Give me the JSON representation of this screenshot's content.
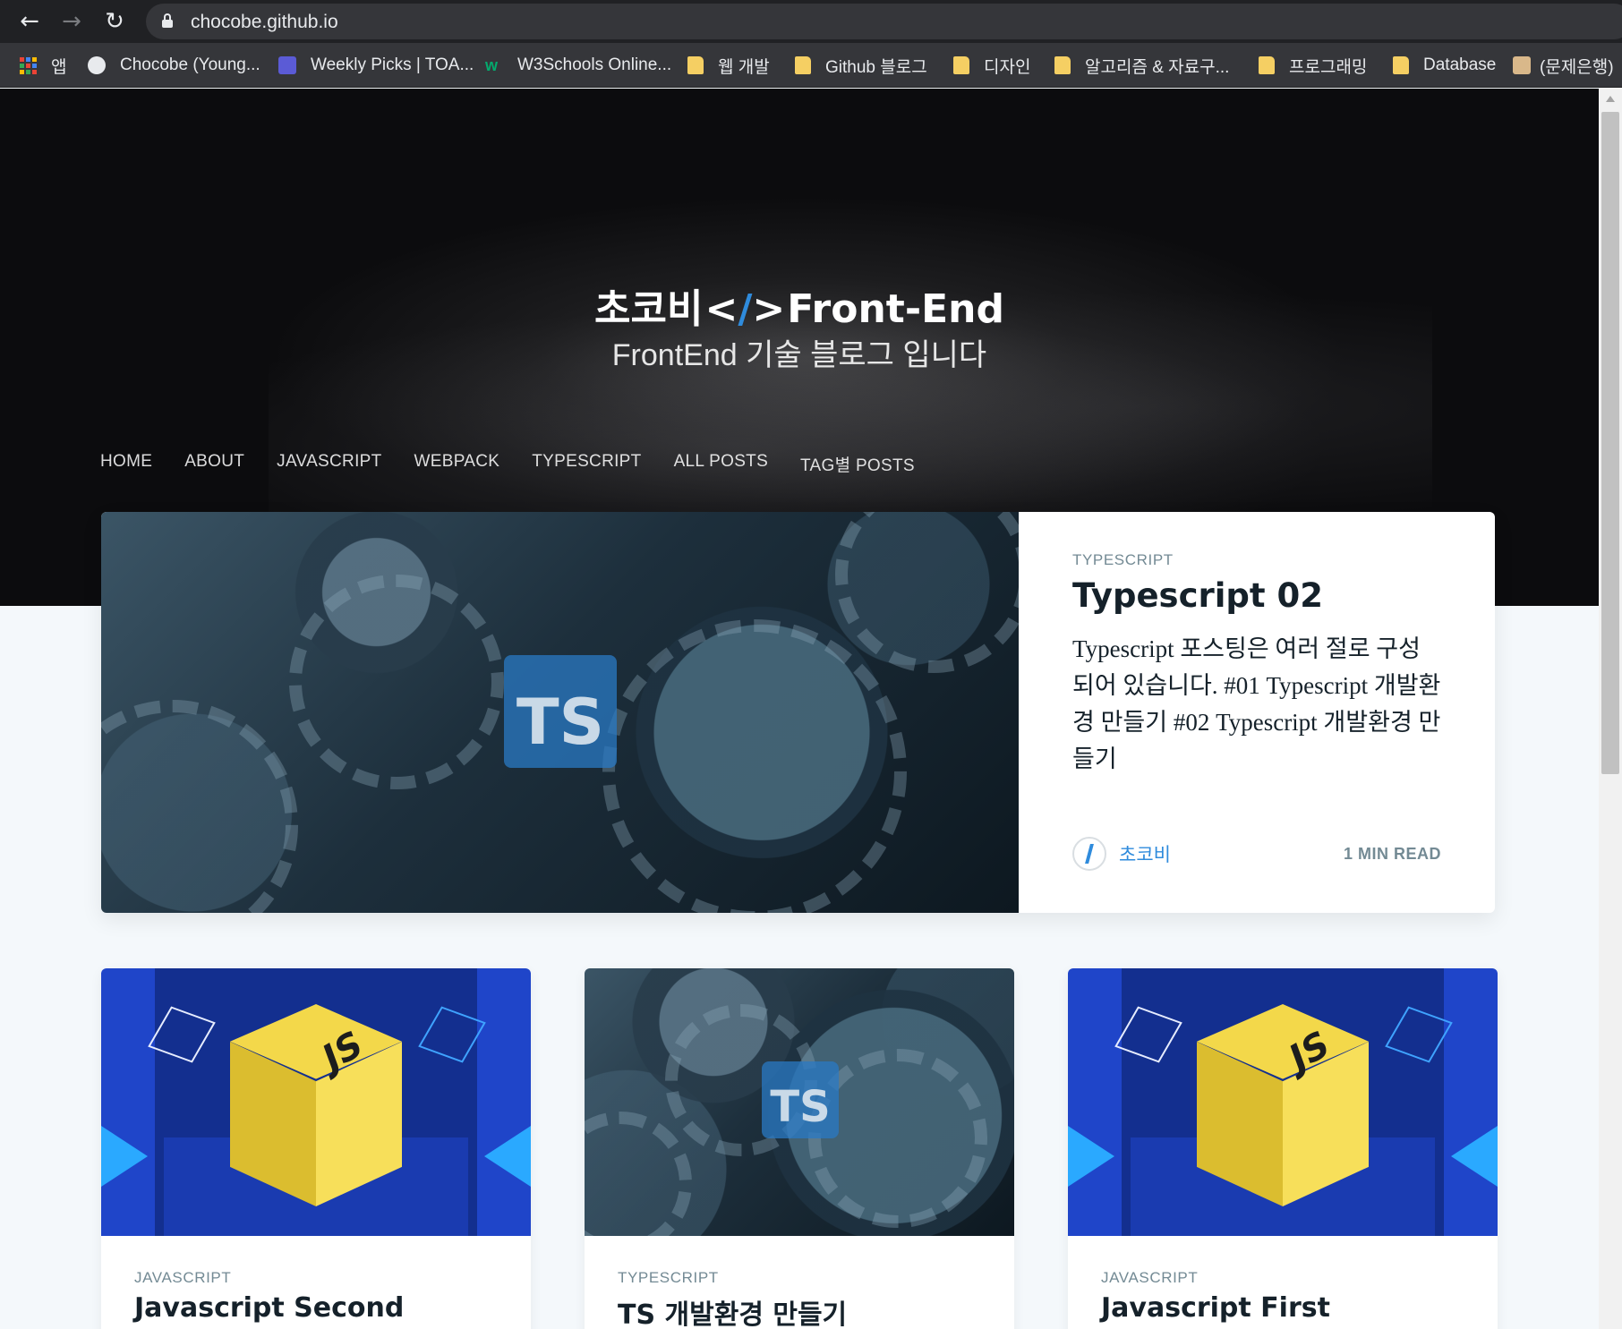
{
  "browser": {
    "url": "chocobe.github.io",
    "back_icon": "←",
    "forward_icon": "→",
    "reload_icon": "↻",
    "bookmarks": [
      {
        "label": "앱",
        "icon": "apps-grid"
      },
      {
        "label": "Chocobe (Young...",
        "icon": "github"
      },
      {
        "label": "Weekly Picks | TOA...",
        "icon": "ui-square"
      },
      {
        "label": "W3Schools Online...",
        "icon": "w3schools"
      },
      {
        "label": "웹 개발",
        "icon": "folder"
      },
      {
        "label": "Github 블로그",
        "icon": "folder"
      },
      {
        "label": "디자인",
        "icon": "folder"
      },
      {
        "label": "알고리즘 & 자료구...",
        "icon": "folder"
      },
      {
        "label": "프로그래밍",
        "icon": "folder"
      },
      {
        "label": "Database",
        "icon": "folder"
      },
      {
        "label": "(문제은행)",
        "icon": "pe"
      }
    ]
  },
  "site": {
    "title_prefix": "초코비",
    "title_mark_open": "<",
    "title_mark_slash": "/",
    "title_mark_close": ">",
    "title_suffix": "Front-End",
    "description": "FrontEnd 기술 블로그 입니다",
    "nav": [
      "HOME",
      "ABOUT",
      "JAVASCRIPT",
      "WEBPACK",
      "TYPESCRIPT",
      "ALL POSTS",
      "TAG별 POSTS"
    ]
  },
  "featured": {
    "tag": "TYPESCRIPT",
    "title": "Typescript 02",
    "excerpt": "Typescript 포스팅은 여러 절로 구성되어 있습니다. #01 Typescript 개발환경 만들기 #02 Typescript 개발환경 만들기",
    "author": "초코비",
    "read_time": "1 MIN READ",
    "image_badge": "TS"
  },
  "posts": [
    {
      "tag": "JAVASCRIPT",
      "title": "Javascript Second",
      "image": "js-cube",
      "badge": "JS"
    },
    {
      "tag": "TYPESCRIPT",
      "title": "TS 개발환경 만들기",
      "image": "ts-gears",
      "badge": "TS"
    },
    {
      "tag": "JAVASCRIPT",
      "title": "Javascript First",
      "image": "js-cube",
      "badge": "JS"
    }
  ],
  "colors": {
    "accent": "#2f8bdc",
    "hero_bg": "#111113",
    "page_bg": "#f4f8fb",
    "folder": "#f5cf63"
  }
}
